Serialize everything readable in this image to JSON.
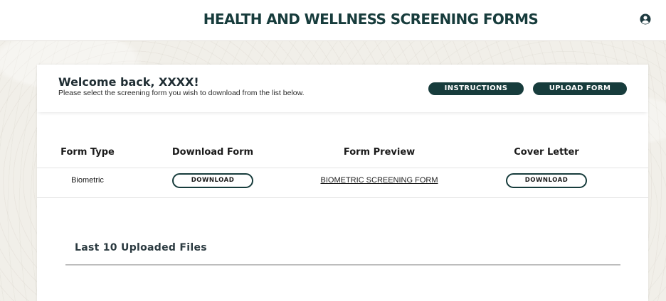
{
  "header": {
    "title": "HEALTH AND WELLNESS SCREENING FORMS",
    "account_icon": "user-circle-icon"
  },
  "welcome": {
    "title": "Welcome back, XXXX!",
    "subtitle": "Please select the screening form you wish to download from the list below."
  },
  "actions": {
    "instructions_label": "INSTRUCTIONS",
    "upload_label": "UPLOAD FORM"
  },
  "table": {
    "columns": [
      "Form Type",
      "Download Form",
      "Form Preview",
      "Cover Letter"
    ],
    "rows": [
      {
        "form_type": "Biometric",
        "download_label": "DOWNLOAD",
        "preview_label": "BIOMETRIC SCREENING FORM",
        "cover_letter_label": "DOWNLOAD"
      }
    ]
  },
  "uploads": {
    "title": "Last 10 Uploaded Files"
  },
  "colors": {
    "brand": "#173c3c",
    "background": "#f1efe9"
  }
}
